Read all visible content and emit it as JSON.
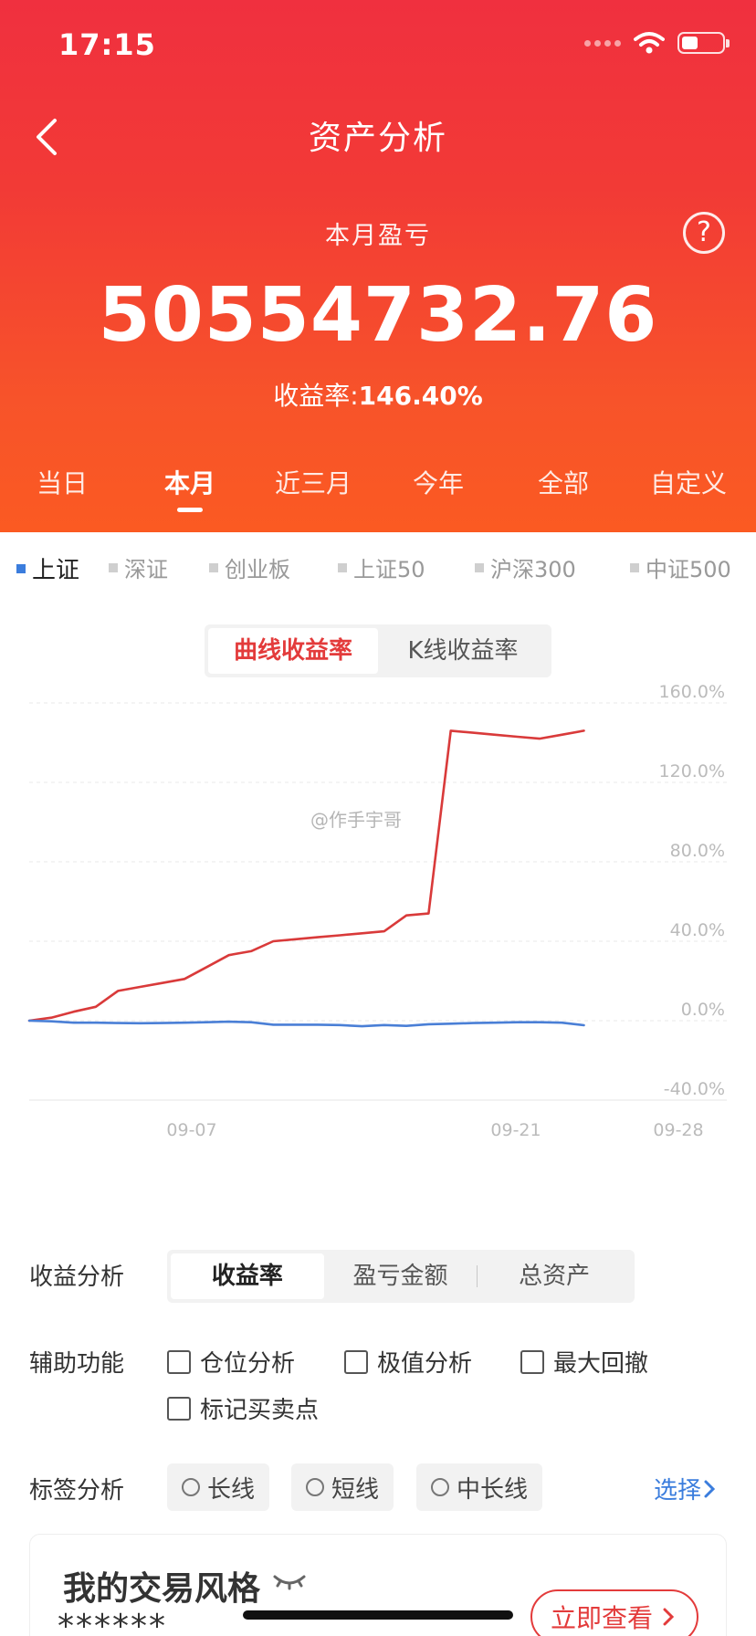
{
  "status_bar": {
    "time": "17:15",
    "battery_level": 0.4
  },
  "nav": {
    "title": "资产分析"
  },
  "summary": {
    "period_label": "本月盈亏",
    "amount": "50554732.76",
    "rate_label": "收益率:",
    "rate_value": "146.40%"
  },
  "period_tabs": [
    {
      "label": "当日",
      "active": false
    },
    {
      "label": "本月",
      "active": true
    },
    {
      "label": "近三月",
      "active": false
    },
    {
      "label": "今年",
      "active": false
    },
    {
      "label": "全部",
      "active": false
    },
    {
      "label": "自定义",
      "active": false
    }
  ],
  "index_tabs": [
    {
      "label": "上证",
      "active": true
    },
    {
      "label": "深证",
      "active": false
    },
    {
      "label": "创业板",
      "active": false
    },
    {
      "label": "上证50",
      "active": false
    },
    {
      "label": "沪深300",
      "active": false
    },
    {
      "label": "中证500",
      "active": false
    }
  ],
  "chart_toggle": {
    "curve": "曲线收益率",
    "kline": "K线收益率"
  },
  "watermark": "@作手宇哥",
  "chart_data": {
    "type": "line",
    "x_ticks": [
      "09-07",
      "09-21",
      "09-28"
    ],
    "y_ticks": [
      "160.0%",
      "120.0%",
      "80.0%",
      "40.0%",
      "0.0%",
      "-40.0%"
    ],
    "ylim": [
      -40,
      160
    ],
    "grid": true,
    "series": [
      {
        "color": "#d93a3a",
        "points": [
          [
            0,
            0
          ],
          [
            1,
            1.5
          ],
          [
            2,
            4.5
          ],
          [
            3,
            7
          ],
          [
            4,
            15
          ],
          [
            5,
            17
          ],
          [
            6,
            19
          ],
          [
            7,
            21
          ],
          [
            8,
            27
          ],
          [
            9,
            33
          ],
          [
            10,
            35
          ],
          [
            11,
            40
          ],
          [
            12,
            41
          ],
          [
            13,
            42
          ],
          [
            14,
            43
          ],
          [
            15,
            44
          ],
          [
            16,
            45
          ],
          [
            17,
            53
          ],
          [
            18,
            54
          ],
          [
            19,
            146
          ],
          [
            20,
            145
          ],
          [
            21,
            144
          ],
          [
            22,
            143
          ],
          [
            23,
            142
          ],
          [
            24,
            144
          ],
          [
            25,
            146
          ]
        ]
      },
      {
        "color": "#4a7fd6",
        "points": [
          [
            0,
            0
          ],
          [
            1,
            -0.3
          ],
          [
            2,
            -1
          ],
          [
            3,
            -1
          ],
          [
            4,
            -1.2
          ],
          [
            5,
            -1.3
          ],
          [
            6,
            -1.2
          ],
          [
            7,
            -1
          ],
          [
            8,
            -0.8
          ],
          [
            9,
            -0.5
          ],
          [
            10,
            -0.8
          ],
          [
            11,
            -2
          ],
          [
            12,
            -2
          ],
          [
            13,
            -2
          ],
          [
            14,
            -2.2
          ],
          [
            15,
            -2.8
          ],
          [
            16,
            -2.2
          ],
          [
            17,
            -2.6
          ],
          [
            18,
            -1.8
          ],
          [
            19,
            -1.5
          ],
          [
            20,
            -1.2
          ],
          [
            21,
            -1
          ],
          [
            22,
            -0.8
          ],
          [
            23,
            -0.8
          ],
          [
            24,
            -1
          ],
          [
            25,
            -2.3
          ]
        ]
      }
    ]
  },
  "profit_analysis": {
    "label": "收益分析",
    "options": [
      {
        "label": "收益率",
        "active": true
      },
      {
        "label": "盈亏金额",
        "active": false
      },
      {
        "label": "总资产",
        "active": false
      }
    ]
  },
  "aux": {
    "label": "辅助功能",
    "items": [
      "仓位分析",
      "极值分析",
      "最大回撤",
      "标记买卖点"
    ]
  },
  "tags": {
    "label": "标签分析",
    "items": [
      "长线",
      "短线",
      "中长线"
    ],
    "select": "选择"
  },
  "style_card": {
    "title": "我的交易风格",
    "masked": "******",
    "button": "立即查看"
  }
}
